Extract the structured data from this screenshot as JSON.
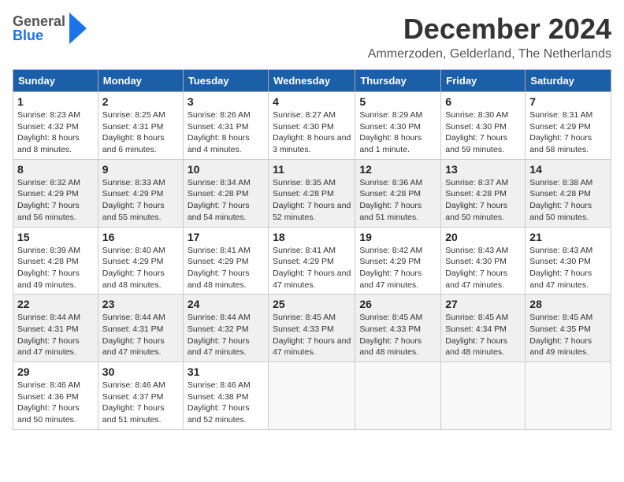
{
  "header": {
    "logo_general": "General",
    "logo_blue": "Blue",
    "month_title": "December 2024",
    "location": "Ammerzoden, Gelderland, The Netherlands"
  },
  "days_of_week": [
    "Sunday",
    "Monday",
    "Tuesday",
    "Wednesday",
    "Thursday",
    "Friday",
    "Saturday"
  ],
  "weeks": [
    [
      {
        "day": "1",
        "sunrise": "Sunrise: 8:23 AM",
        "sunset": "Sunset: 4:32 PM",
        "daylight": "Daylight: 8 hours and 8 minutes."
      },
      {
        "day": "2",
        "sunrise": "Sunrise: 8:25 AM",
        "sunset": "Sunset: 4:31 PM",
        "daylight": "Daylight: 8 hours and 6 minutes."
      },
      {
        "day": "3",
        "sunrise": "Sunrise: 8:26 AM",
        "sunset": "Sunset: 4:31 PM",
        "daylight": "Daylight: 8 hours and 4 minutes."
      },
      {
        "day": "4",
        "sunrise": "Sunrise: 8:27 AM",
        "sunset": "Sunset: 4:30 PM",
        "daylight": "Daylight: 8 hours and 3 minutes."
      },
      {
        "day": "5",
        "sunrise": "Sunrise: 8:29 AM",
        "sunset": "Sunset: 4:30 PM",
        "daylight": "Daylight: 8 hours and 1 minute."
      },
      {
        "day": "6",
        "sunrise": "Sunrise: 8:30 AM",
        "sunset": "Sunset: 4:30 PM",
        "daylight": "Daylight: 7 hours and 59 minutes."
      },
      {
        "day": "7",
        "sunrise": "Sunrise: 8:31 AM",
        "sunset": "Sunset: 4:29 PM",
        "daylight": "Daylight: 7 hours and 58 minutes."
      }
    ],
    [
      {
        "day": "8",
        "sunrise": "Sunrise: 8:32 AM",
        "sunset": "Sunset: 4:29 PM",
        "daylight": "Daylight: 7 hours and 56 minutes."
      },
      {
        "day": "9",
        "sunrise": "Sunrise: 8:33 AM",
        "sunset": "Sunset: 4:29 PM",
        "daylight": "Daylight: 7 hours and 55 minutes."
      },
      {
        "day": "10",
        "sunrise": "Sunrise: 8:34 AM",
        "sunset": "Sunset: 4:28 PM",
        "daylight": "Daylight: 7 hours and 54 minutes."
      },
      {
        "day": "11",
        "sunrise": "Sunrise: 8:35 AM",
        "sunset": "Sunset: 4:28 PM",
        "daylight": "Daylight: 7 hours and 52 minutes."
      },
      {
        "day": "12",
        "sunrise": "Sunrise: 8:36 AM",
        "sunset": "Sunset: 4:28 PM",
        "daylight": "Daylight: 7 hours and 51 minutes."
      },
      {
        "day": "13",
        "sunrise": "Sunrise: 8:37 AM",
        "sunset": "Sunset: 4:28 PM",
        "daylight": "Daylight: 7 hours and 50 minutes."
      },
      {
        "day": "14",
        "sunrise": "Sunrise: 8:38 AM",
        "sunset": "Sunset: 4:28 PM",
        "daylight": "Daylight: 7 hours and 50 minutes."
      }
    ],
    [
      {
        "day": "15",
        "sunrise": "Sunrise: 8:39 AM",
        "sunset": "Sunset: 4:28 PM",
        "daylight": "Daylight: 7 hours and 49 minutes."
      },
      {
        "day": "16",
        "sunrise": "Sunrise: 8:40 AM",
        "sunset": "Sunset: 4:29 PM",
        "daylight": "Daylight: 7 hours and 48 minutes."
      },
      {
        "day": "17",
        "sunrise": "Sunrise: 8:41 AM",
        "sunset": "Sunset: 4:29 PM",
        "daylight": "Daylight: 7 hours and 48 minutes."
      },
      {
        "day": "18",
        "sunrise": "Sunrise: 8:41 AM",
        "sunset": "Sunset: 4:29 PM",
        "daylight": "Daylight: 7 hours and 47 minutes."
      },
      {
        "day": "19",
        "sunrise": "Sunrise: 8:42 AM",
        "sunset": "Sunset: 4:29 PM",
        "daylight": "Daylight: 7 hours and 47 minutes."
      },
      {
        "day": "20",
        "sunrise": "Sunrise: 8:43 AM",
        "sunset": "Sunset: 4:30 PM",
        "daylight": "Daylight: 7 hours and 47 minutes."
      },
      {
        "day": "21",
        "sunrise": "Sunrise: 8:43 AM",
        "sunset": "Sunset: 4:30 PM",
        "daylight": "Daylight: 7 hours and 47 minutes."
      }
    ],
    [
      {
        "day": "22",
        "sunrise": "Sunrise: 8:44 AM",
        "sunset": "Sunset: 4:31 PM",
        "daylight": "Daylight: 7 hours and 47 minutes."
      },
      {
        "day": "23",
        "sunrise": "Sunrise: 8:44 AM",
        "sunset": "Sunset: 4:31 PM",
        "daylight": "Daylight: 7 hours and 47 minutes."
      },
      {
        "day": "24",
        "sunrise": "Sunrise: 8:44 AM",
        "sunset": "Sunset: 4:32 PM",
        "daylight": "Daylight: 7 hours and 47 minutes."
      },
      {
        "day": "25",
        "sunrise": "Sunrise: 8:45 AM",
        "sunset": "Sunset: 4:33 PM",
        "daylight": "Daylight: 7 hours and 47 minutes."
      },
      {
        "day": "26",
        "sunrise": "Sunrise: 8:45 AM",
        "sunset": "Sunset: 4:33 PM",
        "daylight": "Daylight: 7 hours and 48 minutes."
      },
      {
        "day": "27",
        "sunrise": "Sunrise: 8:45 AM",
        "sunset": "Sunset: 4:34 PM",
        "daylight": "Daylight: 7 hours and 48 minutes."
      },
      {
        "day": "28",
        "sunrise": "Sunrise: 8:45 AM",
        "sunset": "Sunset: 4:35 PM",
        "daylight": "Daylight: 7 hours and 49 minutes."
      }
    ],
    [
      {
        "day": "29",
        "sunrise": "Sunrise: 8:46 AM",
        "sunset": "Sunset: 4:36 PM",
        "daylight": "Daylight: 7 hours and 50 minutes."
      },
      {
        "day": "30",
        "sunrise": "Sunrise: 8:46 AM",
        "sunset": "Sunset: 4:37 PM",
        "daylight": "Daylight: 7 hours and 51 minutes."
      },
      {
        "day": "31",
        "sunrise": "Sunrise: 8:46 AM",
        "sunset": "Sunset: 4:38 PM",
        "daylight": "Daylight: 7 hours and 52 minutes."
      },
      {
        "day": "",
        "sunrise": "",
        "sunset": "",
        "daylight": ""
      },
      {
        "day": "",
        "sunrise": "",
        "sunset": "",
        "daylight": ""
      },
      {
        "day": "",
        "sunrise": "",
        "sunset": "",
        "daylight": ""
      },
      {
        "day": "",
        "sunrise": "",
        "sunset": "",
        "daylight": ""
      }
    ]
  ]
}
